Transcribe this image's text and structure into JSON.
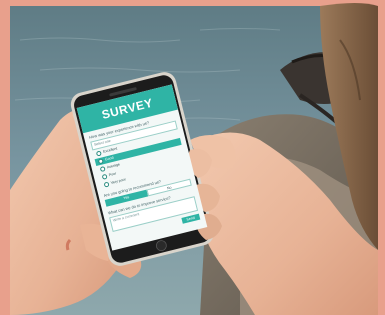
{
  "survey": {
    "title": "SURVEY",
    "q1": "How was your experience with us?",
    "select_placeholder": "Select one",
    "options": [
      "Excellent",
      "Good",
      "Average",
      "Poor",
      "Very poor"
    ],
    "selected_option": "Good",
    "q2": "Are you going to recommend us?",
    "yes_label": "Yes",
    "no_label": "No",
    "q3": "What can we do to improve service?",
    "text_placeholder": "Write a comment",
    "send_label": "Send"
  },
  "colors": {
    "frame": "#e8a08c",
    "sea": "#6f8a90",
    "screen_accent": "#2fb4a5",
    "phone_body": "#d8d4cc"
  },
  "icons": [
    "radio-button-icon"
  ]
}
